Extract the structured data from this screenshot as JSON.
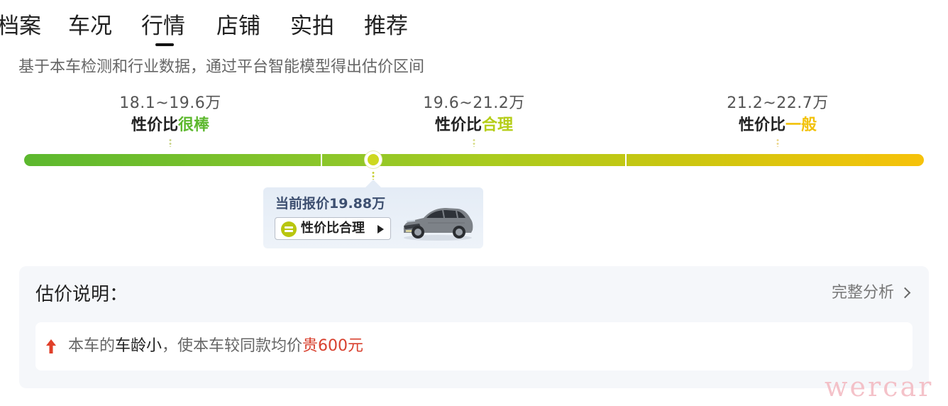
{
  "tabs": [
    {
      "label": "档案",
      "active": false
    },
    {
      "label": "车况",
      "active": false
    },
    {
      "label": "行情",
      "active": true
    },
    {
      "label": "店铺",
      "active": false
    },
    {
      "label": "实拍",
      "active": false
    },
    {
      "label": "推荐",
      "active": false
    }
  ],
  "subtitle": "基于本车检测和行业数据，通过平台智能模型得出估价区间",
  "segments": [
    {
      "range": "18.1~19.6万",
      "label_prefix": "性价比",
      "label_value": "很棒",
      "color": "#5db82e"
    },
    {
      "range": "19.6~21.2万",
      "label_prefix": "性价比",
      "label_value": "合理",
      "color": "#b5cd17"
    },
    {
      "range": "21.2~22.7万",
      "label_prefix": "性价比",
      "label_value": "一般",
      "color": "#f2c20b"
    }
  ],
  "current_price_card": {
    "title": "当前报价19.88万",
    "badge_label": "性价比合理",
    "badge_icon": "equal-circle-icon",
    "image": "car-photo"
  },
  "explanation": {
    "title": "估价说明：",
    "link_label": "完整分析",
    "reason": {
      "icon": "arrow-up-icon",
      "prefix": "本车的",
      "highlight": "车龄小",
      "middle": "，使本车较同款均价",
      "value": "贵600元"
    }
  },
  "watermark": "wercar"
}
